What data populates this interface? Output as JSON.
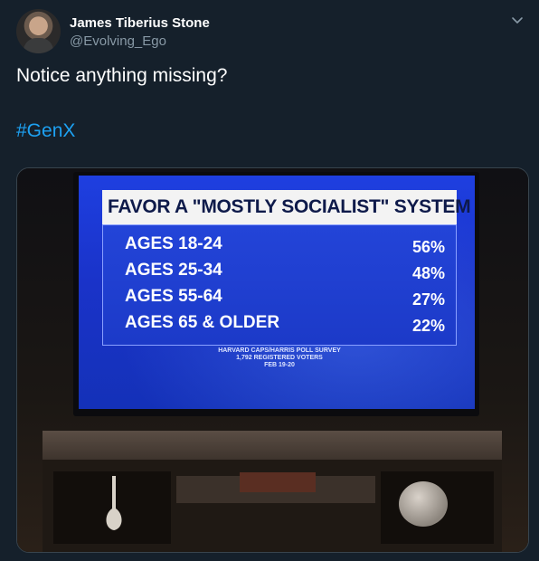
{
  "tweet": {
    "author_name": "James Tiberius Stone",
    "author_handle": "@Evolving_Ego",
    "text": "Notice anything missing?",
    "hashtag": "#GenX",
    "colors": {
      "background": "#15202b",
      "link": "#1da1f2",
      "secondary_text": "#8899a6"
    }
  },
  "tv_graphic": {
    "headline": "FAVOR A \"MOSTLY SOCIALIST\" SYSTEM",
    "rows": [
      {
        "age": "AGES 18-24",
        "percent": "56%"
      },
      {
        "age": "AGES 25-34",
        "percent": "48%"
      },
      {
        "age": "AGES 55-64",
        "percent": "27%"
      },
      {
        "age": "AGES 65 & OLDER",
        "percent": "22%"
      }
    ],
    "source_line1": "HARVARD CAPS/HARRIS POLL SURVEY",
    "source_line2": "1,792 REGISTERED VOTERS",
    "source_line3": "FEB 19-20"
  }
}
